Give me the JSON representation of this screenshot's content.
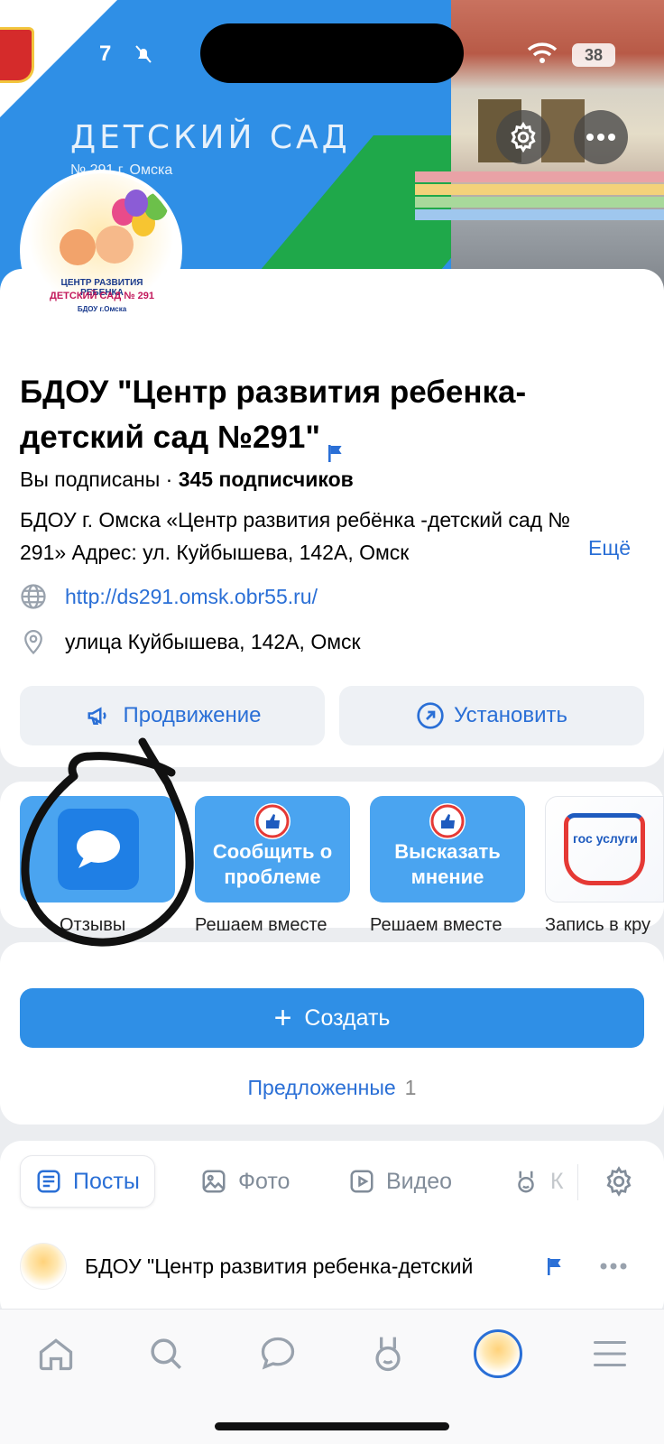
{
  "status_bar": {
    "time": "7",
    "battery": "38"
  },
  "cover": {
    "title": "ДЕТСКИЙ САД",
    "subtitle": "№ 291 г. Омска"
  },
  "avatar": {
    "line1": "ЦЕНТР РАЗВИТИЯ РЕБЕНКА",
    "line2": "ДЕТСКИЙ САД № 291",
    "line3": "БДОУ    г.Омска"
  },
  "community": {
    "name": "БДОУ \"Центр развития ребенка-детский сад №291\"",
    "subscribed": "Вы подписаны · ",
    "subscribers": "345 подписчиков",
    "description": "БДОУ г. Омска  «Центр развития ребёнка -детский сад № 291» Адрес: ул. Куйбышева, 142А, Омск",
    "more": "Ещё",
    "website": "http://ds291.omsk.obr55.ru/",
    "address": "улица Куйбышева, 142А, Омск"
  },
  "actions": {
    "promote": "Продвижение",
    "install": "Установить"
  },
  "apps": [
    {
      "label": "Отзывы",
      "caption": ""
    },
    {
      "label": "Решаем вместе",
      "caption": "Сообщить о проблеме"
    },
    {
      "label": "Решаем вместе",
      "caption": "Высказать мнение"
    },
    {
      "label": "Запись в кру",
      "caption": "гос услуги"
    }
  ],
  "create": {
    "label": "Создать",
    "suggested": "Предложенные",
    "suggested_count": "1"
  },
  "tabs": {
    "posts": "Посты",
    "photo": "Фото",
    "video": "Видео",
    "clips": "К"
  },
  "post": {
    "author": "БДОУ \"Центр развития ребенка-детский"
  },
  "colors": {
    "accent": "#2a6fd6",
    "primary_button": "#2f8fe6",
    "tile_blue": "#4aa4f0"
  }
}
